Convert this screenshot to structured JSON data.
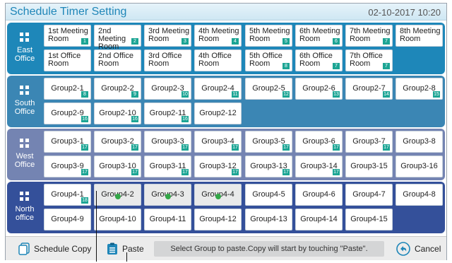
{
  "header": {
    "title": "Schedule Timer Setting",
    "datetime": "02-10-2017  10:20"
  },
  "sections": [
    {
      "name": "East Office",
      "rows": [
        [
          {
            "label": "1st Meeting Room",
            "badge": "1"
          },
          {
            "label": "2nd Meeting Room",
            "badge": "2"
          },
          {
            "label": "3rd Meeting Room",
            "badge": "3"
          },
          {
            "label": "4th Meeting Room",
            "badge": "4"
          },
          {
            "label": "5th Meeting Room",
            "badge": "5"
          },
          {
            "label": "6th Meeting Room",
            "badge": "6"
          },
          {
            "label": "7th Meeting Room",
            "badge": "7"
          },
          {
            "label": "8th Meeting Room",
            "badge": ""
          }
        ],
        [
          {
            "label": "1st Office Room",
            "badge": ""
          },
          {
            "label": "2nd Office Room",
            "badge": ""
          },
          {
            "label": "3rd Office Room",
            "badge": ""
          },
          {
            "label": "4th Office Room",
            "badge": ""
          },
          {
            "label": "5th Office Room",
            "badge": "8"
          },
          {
            "label": "6th Office Room",
            "badge": "7"
          },
          {
            "label": "7th Office Room",
            "badge": "7"
          }
        ]
      ]
    },
    {
      "name": "South Office",
      "rows": [
        [
          {
            "label": "Group2-1",
            "badge": "8"
          },
          {
            "label": "Group2-2",
            "badge": "9"
          },
          {
            "label": "Group2-3",
            "badge": "10"
          },
          {
            "label": "Group2-4",
            "badge": "11"
          },
          {
            "label": "Group2-5",
            "badge": "12"
          },
          {
            "label": "Group2-6",
            "badge": "13"
          },
          {
            "label": "Group2-7",
            "badge": "14"
          },
          {
            "label": "Group2-8",
            "badge": "15"
          }
        ],
        [
          {
            "label": "Group2-9",
            "badge": "16"
          },
          {
            "label": "Group2-10",
            "badge": "16"
          },
          {
            "label": "Group2-11",
            "badge": "16"
          },
          {
            "label": "Group2-12",
            "badge": ""
          }
        ]
      ]
    },
    {
      "name": "West Office",
      "rows": [
        [
          {
            "label": "Group3-1",
            "badge": "17"
          },
          {
            "label": "Group3-2",
            "badge": "17"
          },
          {
            "label": "Group3-3",
            "badge": "17"
          },
          {
            "label": "Group3-4",
            "badge": "17"
          },
          {
            "label": "Group3-5",
            "badge": "17"
          },
          {
            "label": "Group3-6",
            "badge": "17"
          },
          {
            "label": "Group3-7",
            "badge": "17"
          },
          {
            "label": "Group3-8",
            "badge": ""
          }
        ],
        [
          {
            "label": "Group3-9",
            "badge": "17"
          },
          {
            "label": "Group3-10",
            "badge": "17"
          },
          {
            "label": "Group3-11",
            "badge": "17"
          },
          {
            "label": "Group3-12",
            "badge": "17"
          },
          {
            "label": "Group3-13",
            "badge": "17"
          },
          {
            "label": "Group3-14",
            "badge": "17"
          },
          {
            "label": "Group3-15",
            "badge": ""
          },
          {
            "label": "Group3-16",
            "badge": ""
          }
        ]
      ]
    },
    {
      "name": "North office",
      "rows": [
        [
          {
            "label": "Group4-1",
            "badge": "18",
            "selected": false
          },
          {
            "label": "Group4-2",
            "badge": "",
            "selected": true
          },
          {
            "label": "Group4-3",
            "badge": "",
            "selected": true
          },
          {
            "label": "Group4-4",
            "badge": "",
            "selected": true
          },
          {
            "label": "Group4-5",
            "badge": ""
          },
          {
            "label": "Group4-6",
            "badge": ""
          },
          {
            "label": "Group4-7",
            "badge": ""
          },
          {
            "label": "Group4-8",
            "badge": ""
          }
        ],
        [
          {
            "label": "Group4-9",
            "badge": ""
          },
          {
            "label": "Group4-10",
            "badge": ""
          },
          {
            "label": "Group4-11",
            "badge": ""
          },
          {
            "label": "Group4-12",
            "badge": ""
          },
          {
            "label": "Group4-13",
            "badge": ""
          },
          {
            "label": "Group4-14",
            "badge": ""
          },
          {
            "label": "Group4-15",
            "badge": ""
          }
        ]
      ]
    }
  ],
  "footer": {
    "copy_label": "Schedule Copy",
    "paste_label": "Paste",
    "status_text": "Select Group to paste.Copy will start by touching \"Paste\".",
    "cancel_label": "Cancel"
  },
  "colors": {
    "east": "#1e87b9",
    "south": "#3b86b4",
    "west": "#7484b2",
    "north": "#34509a",
    "badge": "#1ca594",
    "selected_dot": "#33a848"
  },
  "icons": {
    "section": "grid-icon",
    "copy": "copy-icon",
    "paste": "clipboard-icon",
    "cancel": "undo-icon"
  }
}
